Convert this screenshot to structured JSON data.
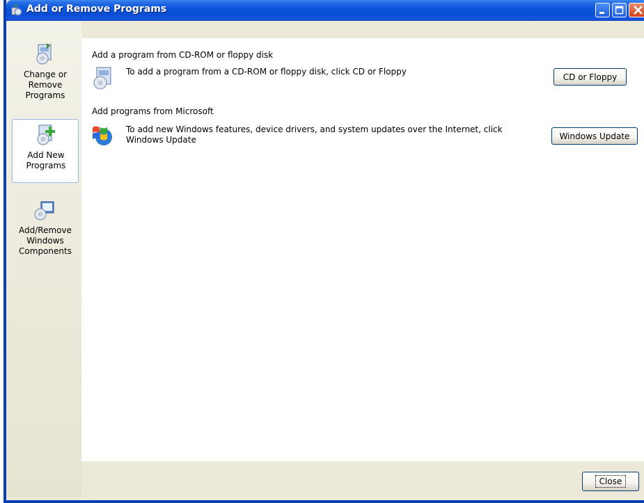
{
  "window": {
    "title": "Add or Remove Programs",
    "colors": {
      "titlebar": "#0A4DD2",
      "frame": "#ECE9D8",
      "close": "#D2421C"
    }
  },
  "titlebar_buttons": {
    "minimize_icon": "minimize-icon",
    "maximize_icon": "maximize-icon",
    "close_icon": "close-icon"
  },
  "sidebar": {
    "items": [
      {
        "label": "Change or\nRemove\nPrograms",
        "icon": "change-remove-icon",
        "selected": false
      },
      {
        "label": "Add New\nPrograms",
        "icon": "add-new-icon",
        "selected": true
      },
      {
        "label": "Add/Remove\nWindows\nComponents",
        "icon": "windows-components-icon",
        "selected": false
      }
    ]
  },
  "main": {
    "sections": [
      {
        "title": "Add a program from CD-ROM or floppy disk",
        "description": "To add a program from a CD-ROM or floppy disk, click CD or Floppy",
        "button_label": "CD or Floppy",
        "icon": "cd-install-icon"
      },
      {
        "title": "Add programs from Microsoft",
        "description": "To add new Windows features, device drivers, and system updates over the Internet, click\nWindows Update",
        "button_label": "Windows Update",
        "icon": "windows-logo-icon"
      }
    ]
  },
  "footer": {
    "close_label": "Close"
  }
}
